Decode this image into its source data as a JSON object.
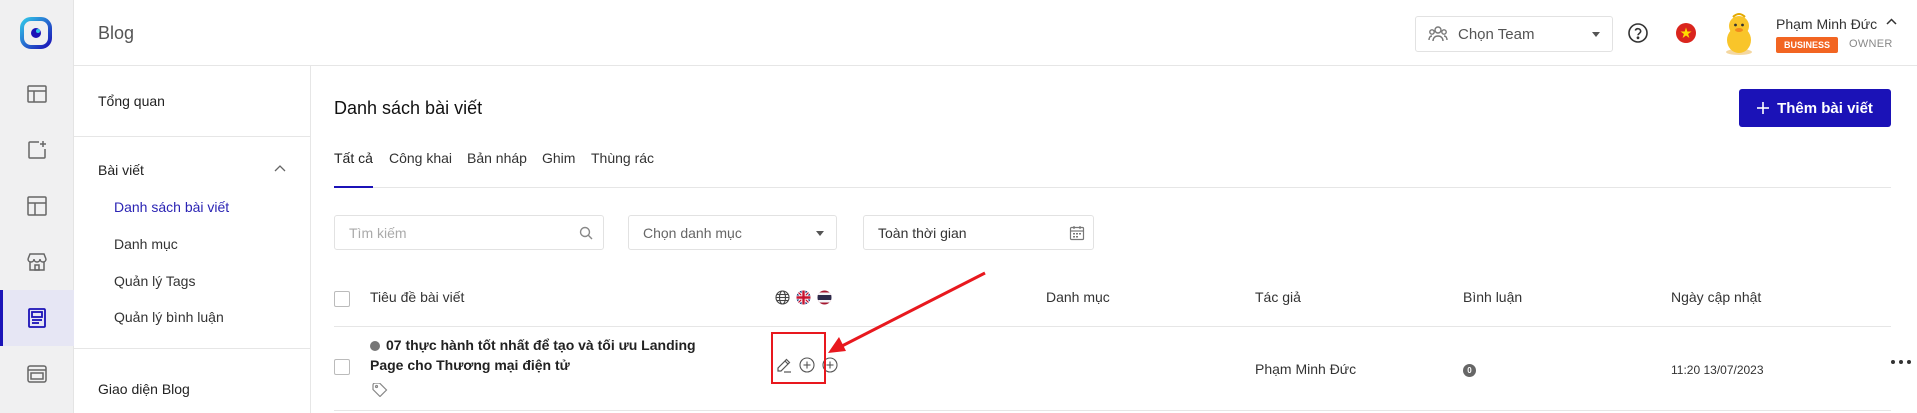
{
  "topbar": {
    "app_title": "Blog",
    "team_select": "Chọn Team",
    "user": {
      "name": "Phạm Minh Đức",
      "plan_badge": "BUSINESS",
      "role": "OWNER"
    }
  },
  "sidebar": {
    "overview": "Tổng quan",
    "posts": "Bài viết",
    "post_list": "Danh sách bài viết",
    "categories": "Danh mục",
    "tags": "Quản lý Tags",
    "comments": "Quản lý bình luận",
    "blog_theme": "Giao diện Blog"
  },
  "main": {
    "title": "Danh sách bài viết",
    "add_button": "Thêm bài viết",
    "tabs": [
      "Tất cả",
      "Công khai",
      "Bản nháp",
      "Ghim",
      "Thùng rác"
    ],
    "filters": {
      "search_placeholder": "Tìm kiếm",
      "category_placeholder": "Chọn danh mục",
      "date_value": "Toàn thời gian"
    },
    "table": {
      "columns": {
        "title": "Tiêu đề bài viết",
        "category": "Danh mục",
        "author": "Tác giả",
        "comments": "Bình luận",
        "updated": "Ngày cập nhật"
      },
      "rows": [
        {
          "title": "07 thực hành tốt nhất để tạo và tối ưu Landing Page cho Thương mại điện tử",
          "category": "",
          "author": "Phạm Minh Đức",
          "comments": "0",
          "updated": "11:20 13/07/2023"
        }
      ]
    }
  },
  "colors": {
    "primary": "#1b12b7",
    "business_badge": "#f26522",
    "annotation": "#e8181e"
  },
  "icons": [
    "logo-icon",
    "layout-icon",
    "add-page-icon",
    "template-icon",
    "store-icon",
    "blog-icon",
    "browser-icon",
    "team-icon",
    "help-icon",
    "vietnam-flag-icon",
    "globe-icon",
    "uk-flag-icon",
    "thailand-flag-icon",
    "edit-icon",
    "add-circle-icon",
    "tag-icon",
    "more-icon",
    "calendar-icon",
    "search-icon"
  ]
}
